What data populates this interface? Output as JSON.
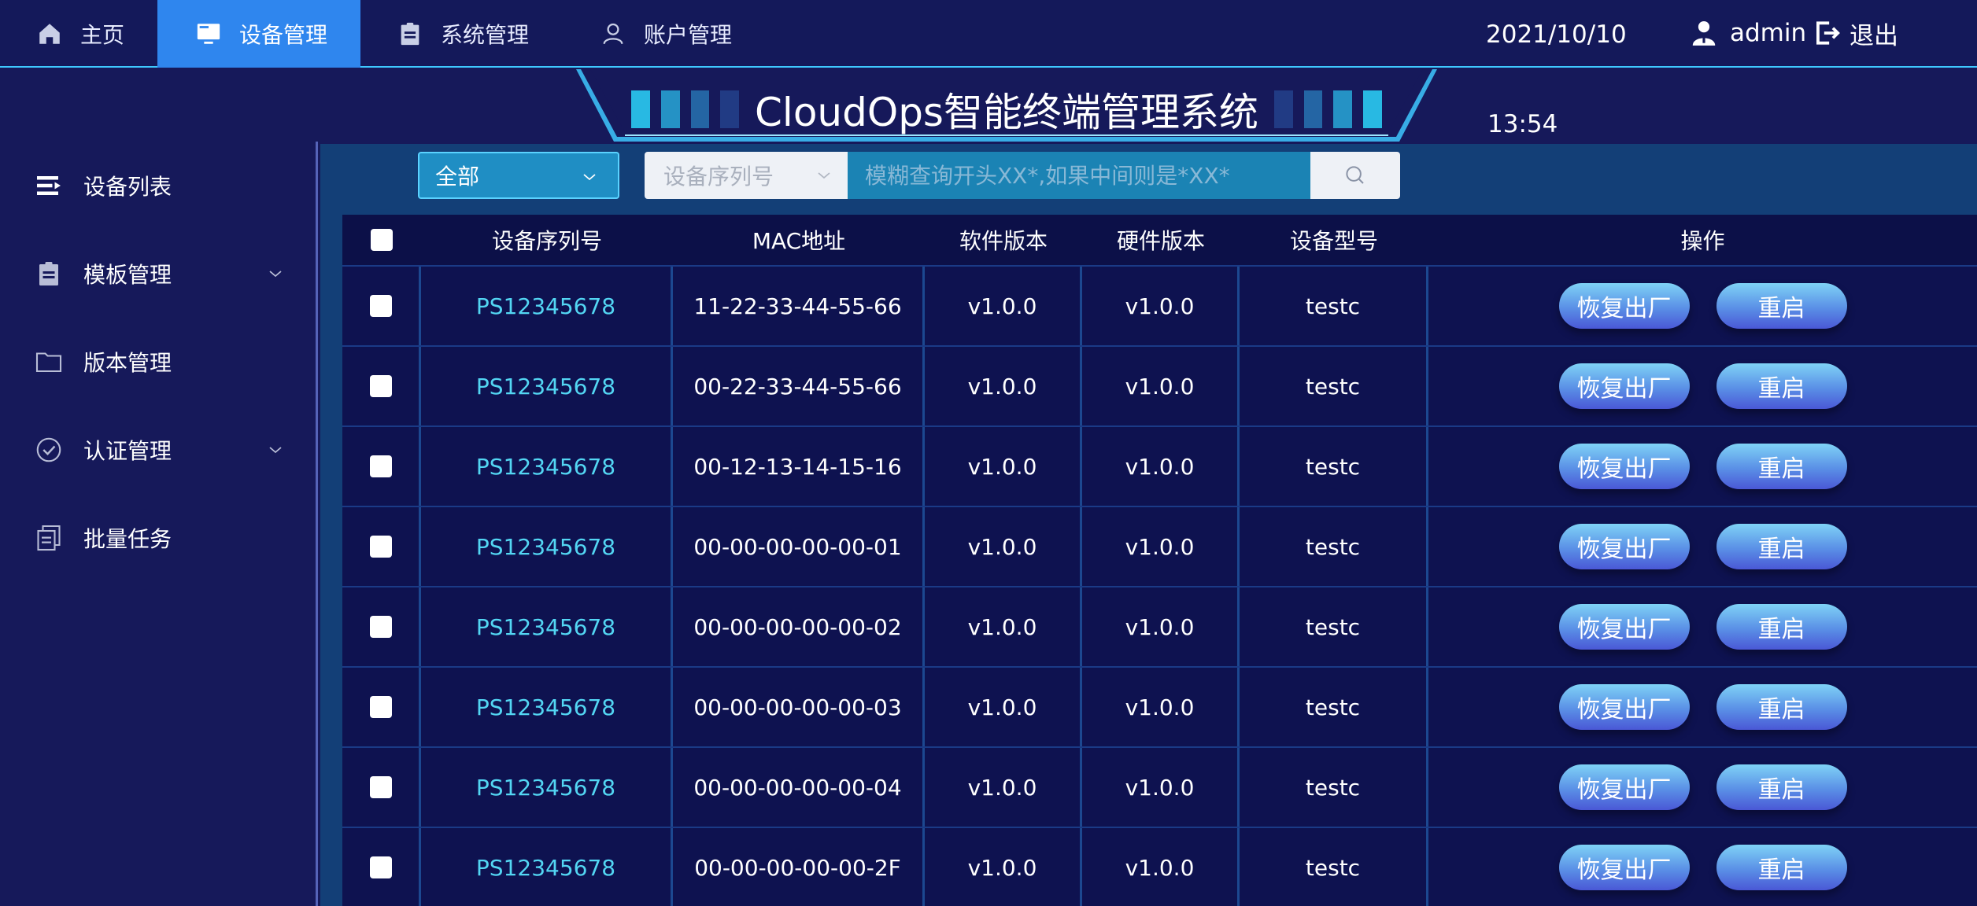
{
  "nav": {
    "items": [
      {
        "label": "主页",
        "icon": "home-icon"
      },
      {
        "label": "设备管理",
        "icon": "monitor-icon",
        "active": true
      },
      {
        "label": "系统管理",
        "icon": "clipboard-icon"
      },
      {
        "label": "账户管理",
        "icon": "user-icon"
      }
    ]
  },
  "header": {
    "date": "2021/10/10",
    "time": "13:54",
    "user": "admin",
    "logout": "退出",
    "title": "CloudOps智能终端管理系统"
  },
  "sidebar": {
    "items": [
      {
        "label": "设备列表",
        "icon": "list-icon"
      },
      {
        "label": "模板管理",
        "icon": "clipboard-icon",
        "expandable": true
      },
      {
        "label": "版本管理",
        "icon": "folder-icon"
      },
      {
        "label": "认证管理",
        "icon": "check-circle-icon",
        "expandable": true
      },
      {
        "label": "批量任务",
        "icon": "copy-icon"
      }
    ]
  },
  "filters": {
    "scope": "全部",
    "field": "设备序列号",
    "search_placeholder": "模糊查询开头XX*,如果中间则是*XX*"
  },
  "table": {
    "headers": [
      "设备序列号",
      "MAC地址",
      "软件版本",
      "硬件版本",
      "设备型号",
      "操作"
    ],
    "rows": [
      {
        "sn": "PS12345678",
        "mac": "11-22-33-44-55-66",
        "sw": "v1.0.0",
        "hw": "v1.0.0",
        "model": "testc"
      },
      {
        "sn": "PS12345678",
        "mac": "00-22-33-44-55-66",
        "sw": "v1.0.0",
        "hw": "v1.0.0",
        "model": "testc"
      },
      {
        "sn": "PS12345678",
        "mac": "00-12-13-14-15-16",
        "sw": "v1.0.0",
        "hw": "v1.0.0",
        "model": "testc"
      },
      {
        "sn": "PS12345678",
        "mac": "00-00-00-00-00-01",
        "sw": "v1.0.0",
        "hw": "v1.0.0",
        "model": "testc"
      },
      {
        "sn": "PS12345678",
        "mac": "00-00-00-00-00-02",
        "sw": "v1.0.0",
        "hw": "v1.0.0",
        "model": "testc"
      },
      {
        "sn": "PS12345678",
        "mac": "00-00-00-00-00-03",
        "sw": "v1.0.0",
        "hw": "v1.0.0",
        "model": "testc"
      },
      {
        "sn": "PS12345678",
        "mac": "00-00-00-00-00-04",
        "sw": "v1.0.0",
        "hw": "v1.0.0",
        "model": "testc"
      },
      {
        "sn": "PS12345678",
        "mac": "00-00-00-00-00-2F",
        "sw": "v1.0.0",
        "hw": "v1.0.0",
        "model": "testc"
      }
    ],
    "actions": {
      "reset": "恢复出厂",
      "reboot": "重启"
    }
  },
  "colors": {
    "background": "#16195a",
    "active_nav": "#2f86ee",
    "accent": "#3ec8ff",
    "serial_text": "#53d6f3",
    "main_panel": "#133f77"
  }
}
